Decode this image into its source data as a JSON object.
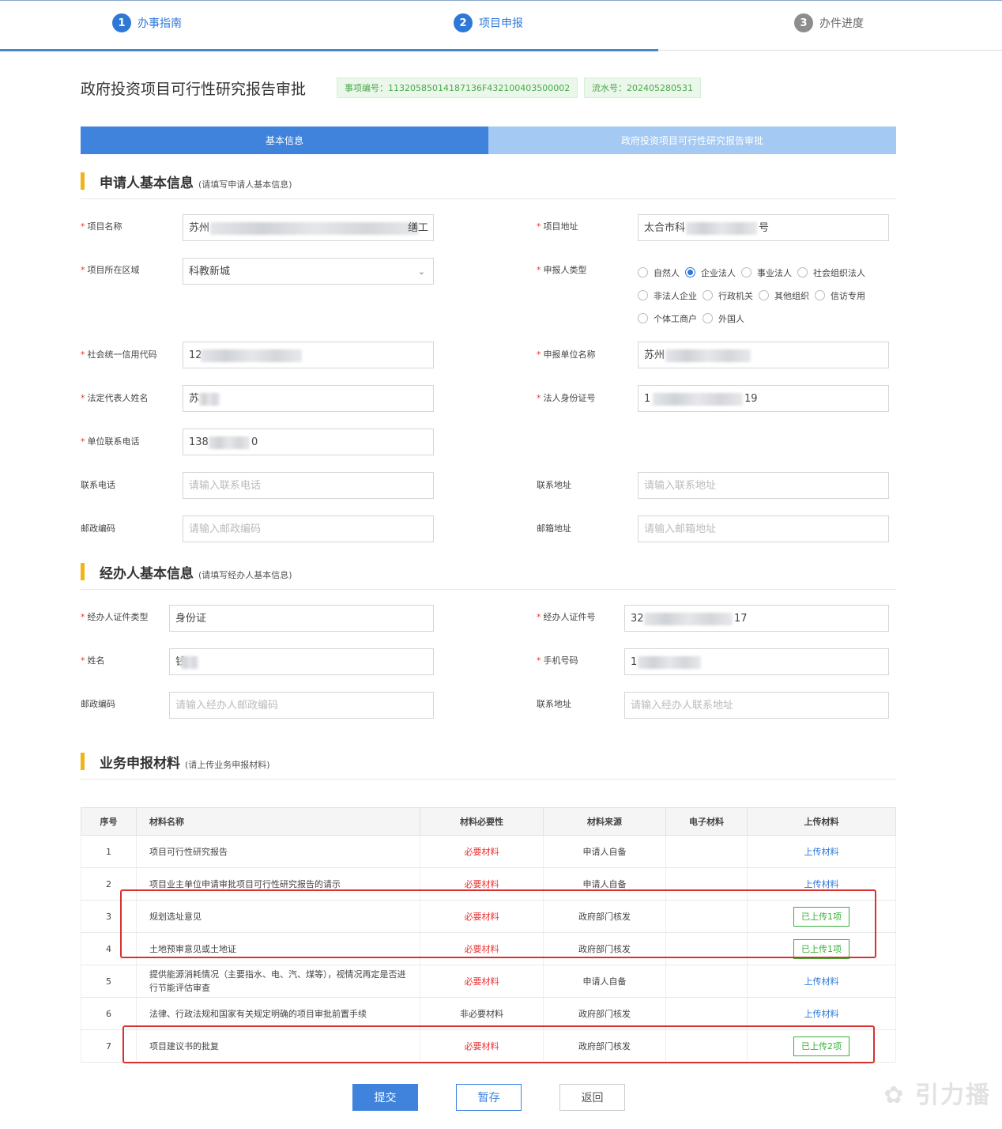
{
  "steps": [
    {
      "num": "1",
      "label": "办事指南"
    },
    {
      "num": "2",
      "label": "项目申报"
    },
    {
      "num": "3",
      "label": "办件进度"
    }
  ],
  "page_title": "政府投资项目可行性研究报告审批",
  "tags": {
    "item_no": "事项编号：11320585014187136F432100403500002",
    "serial_no": "流水号：202405280531"
  },
  "tabs": [
    "基本信息",
    "政府投资项目可行性研究报告审批"
  ],
  "applicant_section": {
    "title": "申请人基本信息",
    "hint": "(请填写申请人基本信息)"
  },
  "applicant": {
    "project_name": {
      "label": "项目名称",
      "value_start": "苏州",
      "value_end": "缮工"
    },
    "project_address": {
      "label": "项目地址",
      "value_start": "太合市科",
      "value_end": "号"
    },
    "region": {
      "label": "项目所在区域",
      "value": "科教新城"
    },
    "applicant_type": {
      "label": "申报人类型",
      "options": [
        "自然人",
        "企业法人",
        "事业法人",
        "社会组织法人",
        "非法人企业",
        "行政机关",
        "其他组织",
        "信访专用",
        "个体工商户",
        "外国人"
      ],
      "selected": "企业法人"
    },
    "credit_code": {
      "label": "社会统一信用代码",
      "value_start": "12"
    },
    "unit_name": {
      "label": "申报单位名称",
      "value_start": "苏州"
    },
    "legal_rep": {
      "label": "法定代表人姓名",
      "value_start": "苏"
    },
    "legal_id": {
      "label": "法人身份证号",
      "value_start": "1",
      "value_end": "19"
    },
    "unit_phone": {
      "label": "单位联系电话",
      "value_start": "138",
      "value_end": "0"
    },
    "contact_phone": {
      "label": "联系电话",
      "placeholder": "请输入联系电话"
    },
    "contact_address": {
      "label": "联系地址",
      "placeholder": "请输入联系地址"
    },
    "postcode": {
      "label": "邮政编码",
      "placeholder": "请输入邮政编码"
    },
    "mail_address": {
      "label": "邮箱地址",
      "placeholder": "请输入邮箱地址"
    }
  },
  "agent_section": {
    "title": "经办人基本信息",
    "hint": "(请填写经办人基本信息)"
  },
  "agent": {
    "id_type": {
      "label": "经办人证件类型",
      "value": "身份证"
    },
    "id_no": {
      "label": "经办人证件号",
      "value_start": "32",
      "value_end": "17"
    },
    "name": {
      "label": "姓名",
      "value_start": "钱"
    },
    "mobile": {
      "label": "手机号码",
      "value_start": "1"
    },
    "postcode": {
      "label": "邮政编码",
      "placeholder": "请输入经办人邮政编码"
    },
    "address": {
      "label": "联系地址",
      "placeholder": "请输入经办人联系地址"
    }
  },
  "materials_section": {
    "title": "业务申报材料",
    "hint": "(请上传业务申报材料)"
  },
  "materials_table": {
    "headers": [
      "序号",
      "材料名称",
      "材料必要性",
      "材料来源",
      "电子材料",
      "上传材料"
    ],
    "rows": [
      {
        "no": "1",
        "name": "项目可行性研究报告",
        "necessity": "必要材料",
        "required": true,
        "source": "申请人自备",
        "electronic": "",
        "upload": "上传材料",
        "uploaded": false
      },
      {
        "no": "2",
        "name": "项目业主单位申请审批项目可行性研究报告的请示",
        "necessity": "必要材料",
        "required": true,
        "source": "申请人自备",
        "electronic": "",
        "upload": "上传材料",
        "uploaded": false
      },
      {
        "no": "3",
        "name": "规划选址意见",
        "necessity": "必要材料",
        "required": true,
        "source": "政府部门核发",
        "electronic": "",
        "upload": "已上传1项",
        "uploaded": true
      },
      {
        "no": "4",
        "name": "土地预审意见或土地证",
        "necessity": "必要材料",
        "required": true,
        "source": "政府部门核发",
        "electronic": "",
        "upload": "已上传1项",
        "uploaded": true
      },
      {
        "no": "5",
        "name": "提供能源消耗情况（主要指水、电、汽、煤等），视情况再定是否进行节能评估审查",
        "necessity": "必要材料",
        "required": true,
        "source": "申请人自备",
        "electronic": "",
        "upload": "上传材料",
        "uploaded": false
      },
      {
        "no": "6",
        "name": "法律、行政法规和国家有关规定明确的项目审批前置手续",
        "necessity": "非必要材料",
        "required": false,
        "source": "政府部门核发",
        "electronic": "",
        "upload": "上传材料",
        "uploaded": false
      },
      {
        "no": "7",
        "name": "项目建议书的批复",
        "necessity": "必要材料",
        "required": true,
        "source": "政府部门核发",
        "electronic": "",
        "upload": "已上传2项",
        "uploaded": true
      }
    ]
  },
  "buttons": {
    "submit": "提交",
    "save": "暂存",
    "back": "返回"
  },
  "watermark": "引力播",
  "colors": {
    "primary": "#3f83dc",
    "required": "#e33333",
    "uploaded": "#3ab03a",
    "highlight": "#d93030",
    "section_bar": "#f2b318"
  }
}
